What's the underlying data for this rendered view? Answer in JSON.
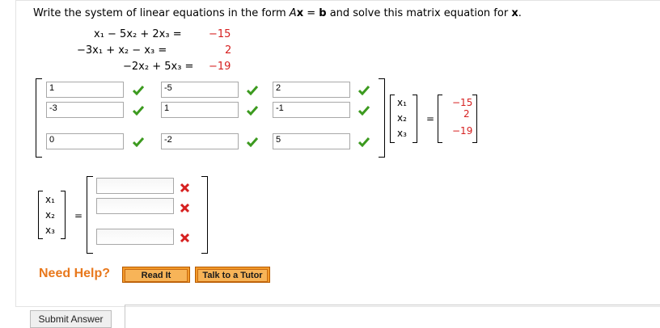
{
  "question": {
    "prefix": "Write the system of linear equations in the form ",
    "A": "A",
    "x1": "x",
    "eq": " = ",
    "b": "b",
    "middle": " and solve this matrix equation for ",
    "x2": "x",
    "end": "."
  },
  "system": [
    {
      "lhs": "x₁  −   5x₂  +  2x₃  =",
      "rhs": "−15"
    },
    {
      "lhs": "−3x₁  +     x₂  −    x₃  =",
      "rhs": "2"
    },
    {
      "lhs": "−2x₂  +  5x₃  =",
      "rhs": "−19"
    }
  ],
  "matrix_A": [
    [
      "1",
      "-5",
      "2"
    ],
    [
      "-3",
      "1",
      "-1"
    ],
    [
      "0",
      "-2",
      "5"
    ]
  ],
  "matrix_A_status": [
    [
      "correct",
      "correct",
      "correct"
    ],
    [
      "correct",
      "correct",
      "correct"
    ],
    [
      "correct",
      "correct",
      "correct"
    ]
  ],
  "vector_x": [
    "x₁",
    "x₂",
    "x₃"
  ],
  "equals": "=",
  "vector_b": [
    "−15",
    "2",
    "−19"
  ],
  "solution_inputs": [
    "",
    "",
    ""
  ],
  "solution_status": [
    "incorrect",
    "incorrect",
    "incorrect"
  ],
  "help": {
    "label": "Need Help?",
    "read_it": "Read It",
    "tutor": "Talk to a Tutor"
  },
  "submit_label": "Submit Answer",
  "colors": {
    "correct": "#3c9a1f",
    "incorrect": "#d62020",
    "constant": "#d62020",
    "help": "#e8781c"
  }
}
